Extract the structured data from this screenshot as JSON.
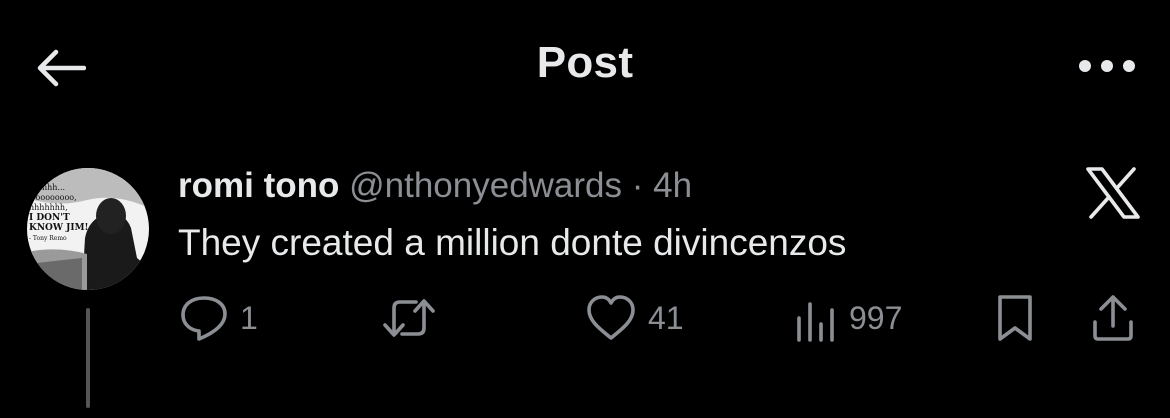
{
  "header": {
    "title": "Post",
    "back_icon": "arrow-left-icon",
    "more_icon": "more-horizontal-icon"
  },
  "post": {
    "name": "romi tono",
    "handle": "@nthonyedwards",
    "separator": "·",
    "time": "4h",
    "text": "They created a million donte divincenzos",
    "avatar_caption": [
      "Hhhh...",
      "Ooooooooo,",
      "hhhhhhh,",
      "I DON'T",
      "KNOW JIM!",
      "- Tony Remo"
    ]
  },
  "actions": {
    "reply_count": "1",
    "repost_count": "",
    "like_count": "41",
    "view_count": "997"
  },
  "colors": {
    "background": "#000000",
    "text": "#e7e9ea",
    "muted": "#8b8f94"
  }
}
